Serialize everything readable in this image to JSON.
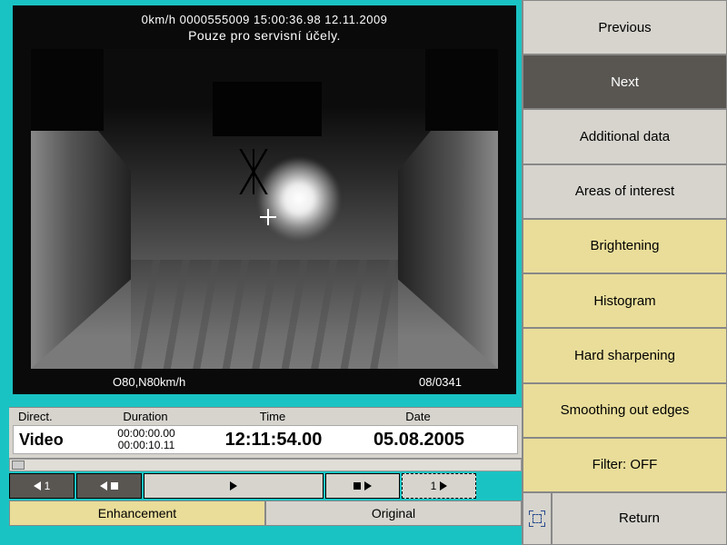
{
  "video": {
    "overlay_top_line1": "0km/h  0000555009  15:00:36.98  12.11.2009",
    "overlay_top_line2": "Pouze pro servisní účely.",
    "overlay_bottom_left": "O80,N80km/h",
    "overlay_bottom_right": "08/0341"
  },
  "info": {
    "headers": {
      "direct": "Direct.",
      "duration": "Duration",
      "time": "Time",
      "date": "Date"
    },
    "direct": "Video",
    "duration_start": "00:00:00.00",
    "duration_end": "00:00:10.11",
    "time": "12:11:54.00",
    "date": "05.08.2005"
  },
  "playback": {
    "step_back": "1",
    "step_fwd": "1"
  },
  "tabs": {
    "enhancement": "Enhancement",
    "original": "Original"
  },
  "menu": {
    "previous": "Previous",
    "next": "Next",
    "additional_data": "Additional data",
    "areas_of_interest": "Areas of interest",
    "brightening": "Brightening",
    "histogram": "Histogram",
    "hard_sharpening": "Hard sharpening",
    "smoothing": "Smoothing out edges",
    "filter": "Filter: OFF",
    "return": "Return"
  }
}
